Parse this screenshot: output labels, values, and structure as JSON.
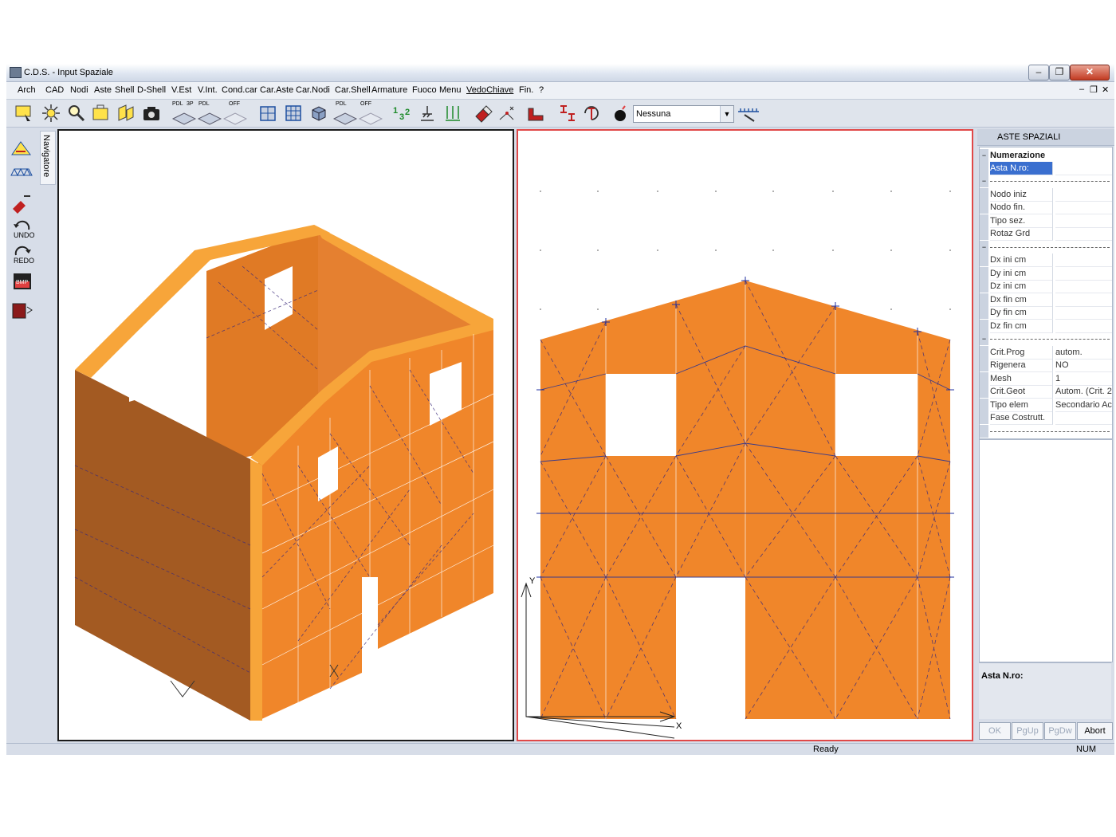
{
  "window": {
    "title": "C.D.S. - Input Spaziale"
  },
  "menu": [
    "Arch",
    "CAD",
    "Nodi",
    "Aste",
    "Shell",
    "D-Shell",
    "V.Est",
    "V.Int.",
    "Cond.car",
    "Car.Aste",
    "Car.Nodi",
    "Car.Shell",
    "Armature",
    "Fuoco",
    "Menu",
    "VedoChiave",
    "Fin.",
    "?"
  ],
  "toolbar": {
    "badges": {
      "pdl1": "PDL",
      "3p": "3P",
      "pdl2": "PDL",
      "off1": "OFF",
      "pdl3": "PDL",
      "off2": "OFF"
    },
    "combo_value": "Nessuna"
  },
  "left_tools": {
    "undo": "UNDO",
    "redo": "REDO",
    "bmp": "BMP"
  },
  "navigator_tab": "Navigatore",
  "panel": {
    "title": "ASTE SPAZIALI",
    "numerazione": "Numerazione",
    "asta_nro": "Asta N.ro:",
    "nodo_iniz": "Nodo iniz",
    "nodo_fin": "Nodo fin.",
    "tipo_sez": "Tipo sez.",
    "rotaz_grd": "Rotaz Grd",
    "dx_ini": "Dx ini cm",
    "dy_ini": "Dy ini cm",
    "dz_ini": "Dz ini cm",
    "dx_fin": "Dx fin cm",
    "dy_fin": "Dy fin cm",
    "dz_fin": "Dz fin cm",
    "crit_prog": "Crit.Prog",
    "crit_prog_val": "autom.",
    "rigenera": "Rigenera",
    "rigenera_val": "NO",
    "mesh": "Mesh",
    "mesh_val": "1",
    "crit_geot": "Crit.Geot",
    "crit_geot_val": "Autom. (Crit. 2",
    "tipo_elem": "Tipo elem",
    "tipo_elem_val": "Secondario Ac",
    "fase_costrutt": "Fase Costrutt.",
    "bottom_label": "Asta N.ro:",
    "buttons": {
      "ok": "OK",
      "pgup": "PgUp",
      "pgdw": "PgDw",
      "abort": "Abort"
    }
  },
  "axis_labels": {
    "y": "Y",
    "x": "X"
  },
  "status": {
    "ready": "Ready",
    "num": "NUM"
  },
  "colors": {
    "wall_face": "#f0862a",
    "wall_top": "#f7a53a",
    "wall_side": "#a35a22",
    "panel_select": "#3a6fcf"
  }
}
